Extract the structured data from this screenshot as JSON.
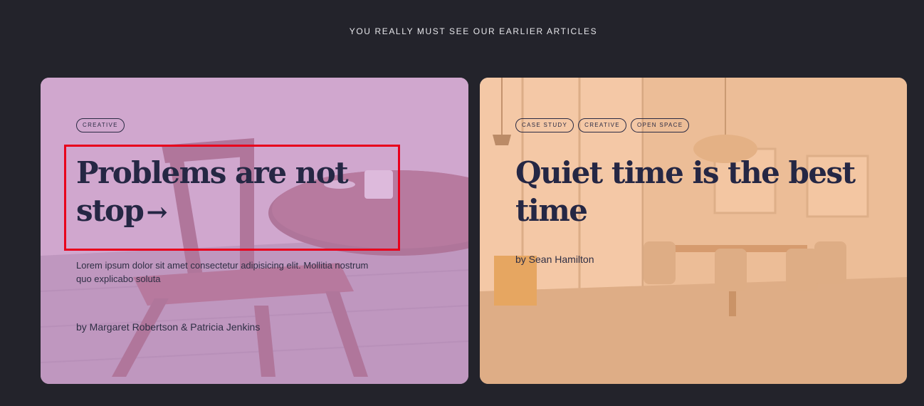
{
  "section": {
    "heading": "YOU REALLY MUST SEE OUR EARLIER ARTICLES"
  },
  "cards": [
    {
      "tags": [
        "CREATIVE"
      ],
      "title": "Problems are not stop",
      "arrow_icon": "arrow-right-icon",
      "excerpt": "Lorem ipsum dolor sit amet consectetur adipisicing elit. Mollitia nostrum quo explicabo soluta",
      "author": "by Margaret Robertson & Patricia Jenkins",
      "overlay_color": "#d6a0d4"
    },
    {
      "tags": [
        "CASE STUDY",
        "CREATIVE",
        "OPEN SPACE"
      ],
      "title": "Quiet time is the best time",
      "author": "by Sean Hamilton",
      "overlay_color": "#fdb480"
    }
  ],
  "highlight_color": "#e8001c"
}
